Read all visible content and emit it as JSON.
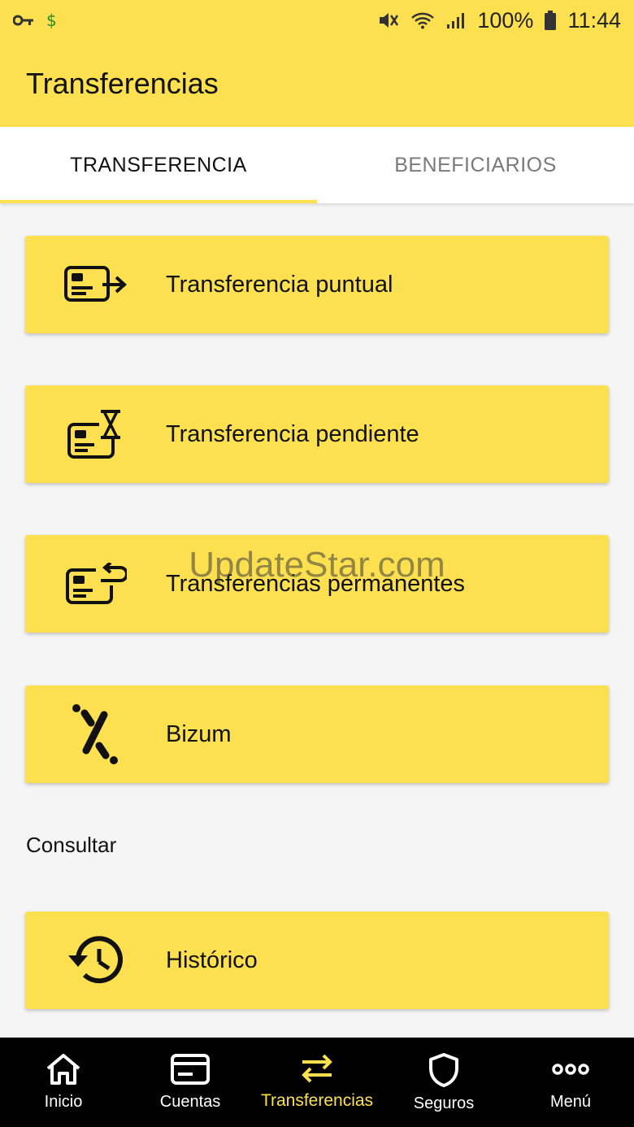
{
  "status_bar": {
    "battery": "100%",
    "time": "11:44"
  },
  "app_bar": {
    "title": "Transferencias"
  },
  "tabs": [
    {
      "label": "TRANSFERENCIA",
      "active": true
    },
    {
      "label": "BENEFICIARIOS",
      "active": false
    }
  ],
  "cards": [
    {
      "label": "Transferencia puntual",
      "icon": "card-arrow-icon"
    },
    {
      "label": "Transferencia pendiente",
      "icon": "card-hourglass-icon"
    },
    {
      "label": "Transferencias permanentes",
      "icon": "card-repeat-icon"
    },
    {
      "label": "Bizum",
      "icon": "bizum-icon"
    }
  ],
  "consultar": {
    "title": "Consultar",
    "cards": [
      {
        "label": "Histórico",
        "icon": "history-icon"
      }
    ]
  },
  "watermark": "UpdateStar.com",
  "bottom_nav": [
    {
      "label": "Inicio",
      "icon": "home-icon",
      "active": false
    },
    {
      "label": "Cuentas",
      "icon": "card-icon",
      "active": false
    },
    {
      "label": "Transferencias",
      "icon": "transfer-arrows-icon",
      "active": true
    },
    {
      "label": "Seguros",
      "icon": "shield-icon",
      "active": false
    },
    {
      "label": "Menú",
      "icon": "more-dots-icon",
      "active": false
    }
  ],
  "colors": {
    "brand_yellow": "#fde04f",
    "nav_background": "#000000",
    "page_background": "#f5f5f5"
  }
}
